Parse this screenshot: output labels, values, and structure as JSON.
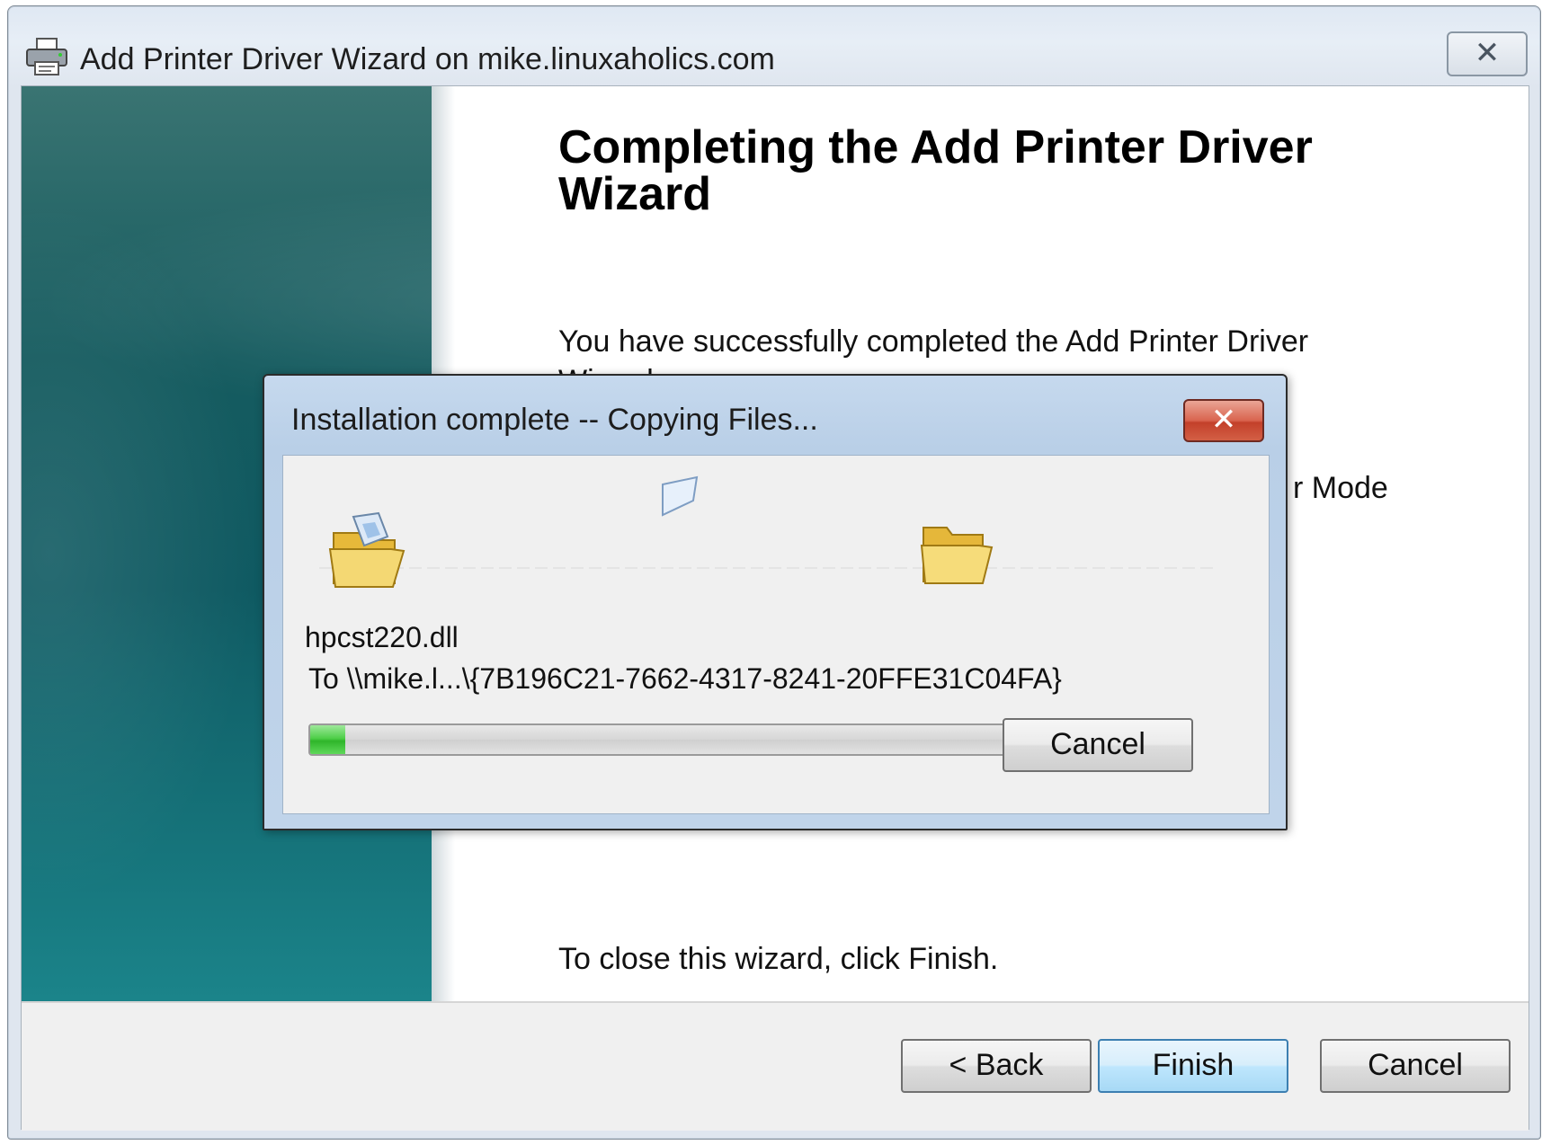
{
  "window": {
    "title": "Add Printer Driver Wizard on mike.linuxaholics.com",
    "close_symbol": "✕",
    "icon": "printer-icon"
  },
  "wizard": {
    "heading": "Completing the Add Printer Driver Wizard",
    "success_text": "You have successfully completed the Add Printer Driver Wizard.",
    "mode_text_fragment": "r Mode",
    "closing_text": "To close this wizard, click Finish.",
    "back_label": "< Back",
    "finish_label": "Finish",
    "cancel_label": "Cancel"
  },
  "copy_dialog": {
    "title": "Installation complete -- Copying Files...",
    "close_symbol": "✕",
    "file_name": "hpcst220.dll",
    "destination": "To \\\\mike.l...\\{7B196C21-7662-4317-8241-20FFE31C04FA}",
    "progress_fraction": 0.05,
    "cancel_label": "Cancel",
    "source_icon": "open-folder-icon",
    "target_icon": "folder-icon",
    "flying_icon": "paper-sheet-icon"
  },
  "colors": {
    "banner_teal": "#0f5a62",
    "progress_green": "#2fb52a",
    "default_button_blue": "#3c7fb1",
    "dialog_close_red": "#c3402a"
  }
}
